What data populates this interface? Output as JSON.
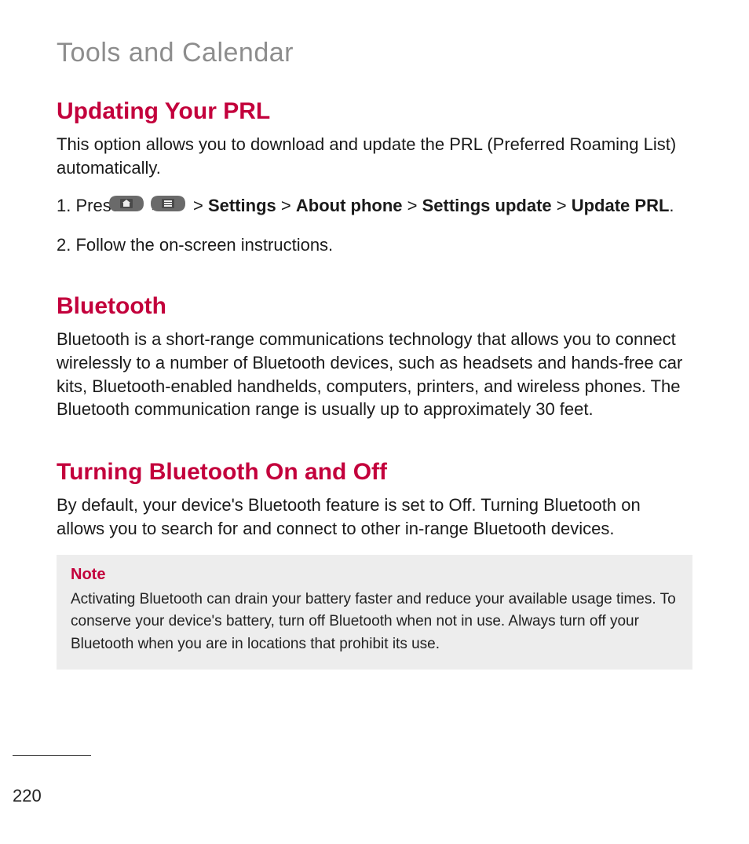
{
  "header": {
    "section_title": "Tools and Calendar"
  },
  "prl": {
    "heading": "Updating Your PRL",
    "intro": "This option allows you to download and update the PRL (Preferred Roaming List) automatically.",
    "step1_prefix": "1. Press ",
    "sep": " > ",
    "path": {
      "settings": "Settings",
      "about": "About phone",
      "sysupdate": "Settings update",
      "updateprl": "Update PRL"
    },
    "step1_suffix": ".",
    "step2": "2. Follow the on-screen instructions."
  },
  "bt": {
    "heading": "Bluetooth",
    "body": "Bluetooth is a short-range communications technology that allows you to connect wirelessly to a number of Bluetooth devices, such as headsets and hands-free car kits, Bluetooth-enabled handhelds, computers, printers, and wireless phones. The Bluetooth communication range is usually up to approximately 30 feet."
  },
  "bt_toggle": {
    "heading": "Turning Bluetooth On and Off",
    "body": "By default, your device's Bluetooth feature is set to Off. Turning Bluetooth on allows you to search for and connect to other in-range Bluetooth devices."
  },
  "note": {
    "title": "Note",
    "body": "Activating Bluetooth can drain your battery faster and reduce your available usage times. To conserve your device's battery, turn off Bluetooth when not in use. Always turn off your Bluetooth when you are in locations that prohibit its use."
  },
  "page_number": "220"
}
